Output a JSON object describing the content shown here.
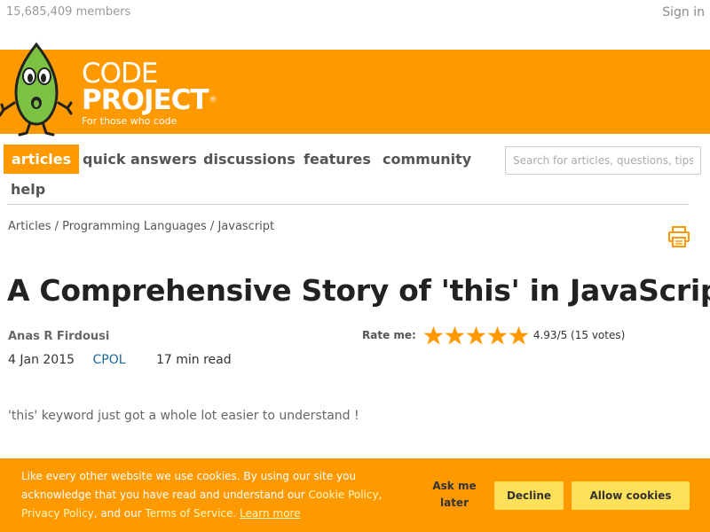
{
  "topbar": {
    "members": "15,685,409 members",
    "sign_in": "Sign in"
  },
  "header": {
    "logo_line1": "CODE",
    "logo_line2": "PROJECT",
    "logo_trademark": "®",
    "tagline": "For those who code",
    "mascot": "bob-mascot-icon",
    "brand_color": "#ff9900"
  },
  "nav": {
    "items": [
      {
        "label": "articles",
        "active": true
      },
      {
        "label": "quick answers",
        "active": false
      },
      {
        "label": "discussions",
        "active": false
      },
      {
        "label": "features",
        "active": false
      },
      {
        "label": "community",
        "active": false
      },
      {
        "label": "help",
        "active": false
      }
    ],
    "search_placeholder": "Search for articles, questions, tips"
  },
  "breadcrumb": "Articles / Programming Languages / Javascript",
  "article": {
    "title": "A Comprehensive Story of 'this' in JavaScript",
    "author": "Anas R Firdousi",
    "date": "4 Jan 2015",
    "license": "CPOL",
    "read_time": "17 min read",
    "summary": "'this' keyword just got a whole lot easier to understand !"
  },
  "rating": {
    "label": "Rate me:",
    "stars": 5,
    "score_text": "4.93/5 (15 votes)",
    "star_color": "#f90"
  },
  "cookie_banner": {
    "text_1": "Like every other website we use cookies. By using our site you acknowledge that you have read and understand our ",
    "cookie_policy": "Cookie Policy",
    "sep_1": ", ",
    "privacy_policy": "Privacy Policy",
    "text_2": ", and our ",
    "terms": "Terms of Service",
    "text_3": ". ",
    "learn_more": "Learn more",
    "ask_later": "Ask me later",
    "decline": "Decline",
    "allow": "Allow cookies",
    "button_color": "#ffe05a"
  }
}
